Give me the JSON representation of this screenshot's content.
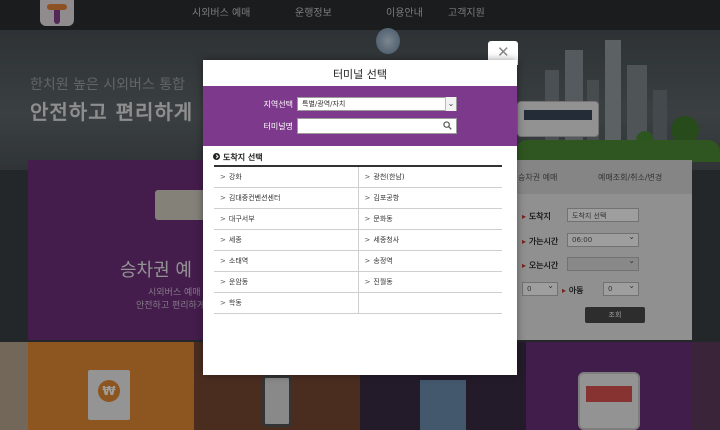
{
  "top_nav": [
    "시외버스 예매",
    "운행정보",
    "이용안내",
    "고객지원"
  ],
  "hero": {
    "subtitle": "한치원 높은 시외버스 통합",
    "title": "안전하고 편리하게"
  },
  "promo": {
    "title": "승차권 예",
    "lines": [
      "시외버스 예매",
      "안전하고 편리하게"
    ]
  },
  "booking": {
    "tabs": [
      "승차권 예매",
      "예매조회/취소/변경"
    ],
    "arrival_label": "도착지",
    "arrival_placeholder": "도착지 선택",
    "depart_time_label": "가는시간",
    "depart_time_value": "06:00",
    "return_time_label": "오는시간",
    "adult_count": "0",
    "child_label": "아동",
    "child_count": "0",
    "search_label": "조회"
  },
  "tiles": {
    "won_symbol": "₩"
  },
  "modal": {
    "title": "터미널 선택",
    "region_label": "지역선택",
    "region_value": "특별/광역/자치",
    "terminal_label": "터미널명",
    "terminal_value": "",
    "destination_heading": "도착지 선택",
    "destinations": [
      [
        "강화",
        "광천(한남)"
      ],
      [
        "김대중컨벤션센터",
        "김포공항"
      ],
      [
        "대구서부",
        "문화동"
      ],
      [
        "세종",
        "세종청사"
      ],
      [
        "소태역",
        "송정역"
      ],
      [
        "운암동",
        "진월동"
      ],
      [
        "학동",
        ""
      ]
    ]
  },
  "colors": {
    "modal_header_purple": "#7d3a8c",
    "promo_purple": "#6f2f7d",
    "tile_orange": "#e48a34"
  },
  "icons": [
    "logo-icon",
    "close-icon",
    "chevron-down-icon",
    "search-icon",
    "circle-arrow-icon",
    "won-icon",
    "phone-icon",
    "building-icon",
    "bus-icon"
  ]
}
